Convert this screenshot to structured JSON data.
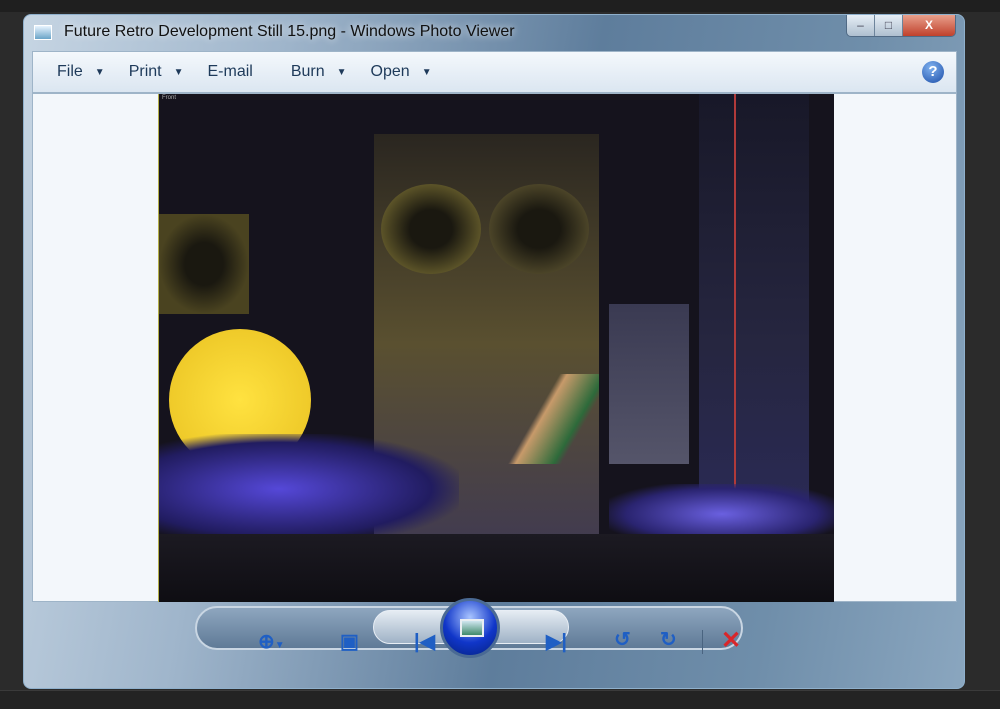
{
  "window": {
    "title": "Future Retro Development Still 15.png - Windows Photo Viewer"
  },
  "caption_buttons": {
    "minimize": "–",
    "maximize": "□",
    "close": "X"
  },
  "menu": [
    {
      "label": "File",
      "dropdown": true
    },
    {
      "label": "Print",
      "dropdown": true
    },
    {
      "label": "E-mail",
      "dropdown": false
    },
    {
      "label": "Burn",
      "dropdown": true
    },
    {
      "label": "Open",
      "dropdown": true
    }
  ],
  "help": "?",
  "photo": {
    "corner_label": "Front"
  },
  "controls": {
    "zoom": "zoom-icon",
    "actual_size": "actual-size-icon",
    "previous": "previous-icon",
    "slideshow": "slideshow-icon",
    "next": "next-icon",
    "rotate_ccw": "rotate-ccw-icon",
    "rotate_cw": "rotate-cw-icon",
    "delete": "delete-icon"
  },
  "colors": {
    "accent": "#1f5fc4",
    "delete": "#d9262a"
  }
}
